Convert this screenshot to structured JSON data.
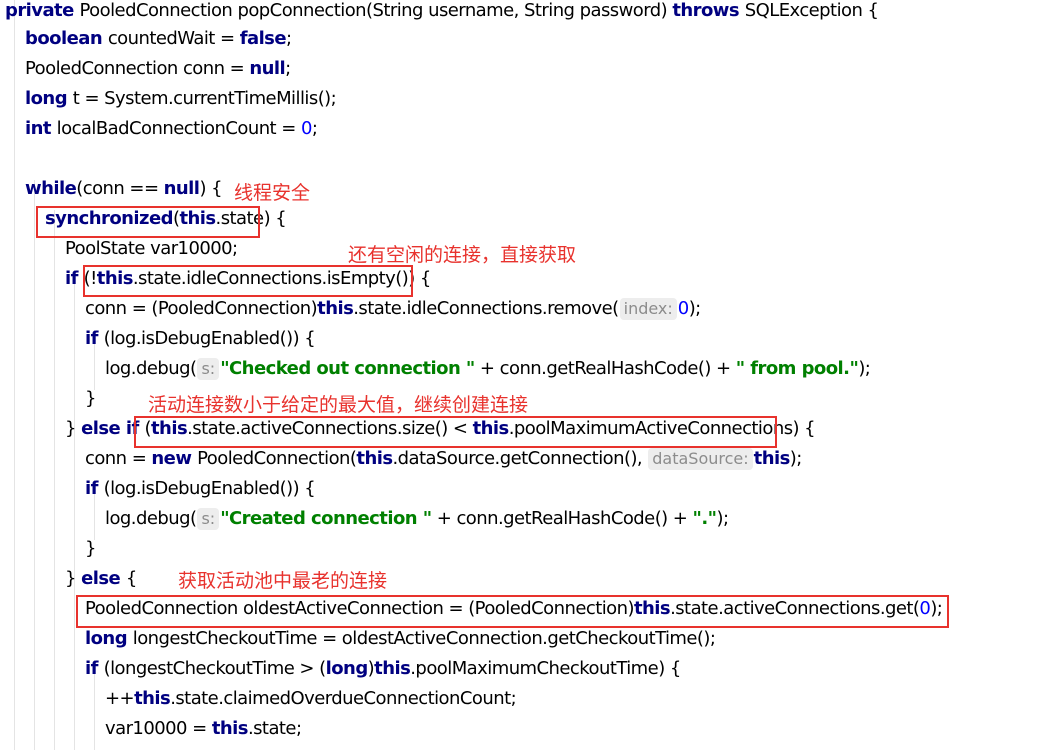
{
  "code_lines": [
    {
      "tokens": [
        {
          "t": "kw",
          "v": "private "
        },
        {
          "t": "p",
          "v": "PooledConnection popConnection(String username, String password) "
        },
        {
          "t": "kw",
          "v": "throws "
        },
        {
          "t": "p",
          "v": "SQLException {"
        }
      ]
    },
    {
      "tokens": [
        {
          "t": "kw",
          "v": "boolean "
        },
        {
          "t": "p",
          "v": "countedWait = "
        },
        {
          "t": "kw",
          "v": "false"
        },
        {
          "t": "p",
          "v": ";"
        }
      ]
    },
    {
      "tokens": [
        {
          "t": "p",
          "v": "PooledConnection conn = "
        },
        {
          "t": "kw",
          "v": "null"
        },
        {
          "t": "p",
          "v": ";"
        }
      ]
    },
    {
      "tokens": [
        {
          "t": "kw",
          "v": "long "
        },
        {
          "t": "p",
          "v": "t = System.currentTimeMillis();"
        }
      ]
    },
    {
      "tokens": [
        {
          "t": "kw",
          "v": "int "
        },
        {
          "t": "p",
          "v": "localBadConnectionCount = "
        },
        {
          "t": "num",
          "v": "0"
        },
        {
          "t": "p",
          "v": ";"
        }
      ]
    },
    {
      "tokens": []
    },
    {
      "tokens": [
        {
          "t": "kw",
          "v": "while"
        },
        {
          "t": "p",
          "v": "(conn == "
        },
        {
          "t": "kw",
          "v": "null"
        },
        {
          "t": "p",
          "v": ") {"
        }
      ]
    },
    {
      "tokens": [
        {
          "t": "kw",
          "v": "synchronized"
        },
        {
          "t": "p",
          "v": "("
        },
        {
          "t": "kw",
          "v": "this"
        },
        {
          "t": "p",
          "v": ".state) {"
        }
      ]
    },
    {
      "tokens": [
        {
          "t": "p",
          "v": "PoolState var10000;"
        }
      ]
    },
    {
      "tokens": [
        {
          "t": "kw",
          "v": "if "
        },
        {
          "t": "p",
          "v": "(!"
        },
        {
          "t": "kw",
          "v": "this"
        },
        {
          "t": "p",
          "v": ".state.idleConnections.isEmpty()) {"
        }
      ]
    },
    {
      "tokens": [
        {
          "t": "p",
          "v": "conn = (PooledConnection)"
        },
        {
          "t": "kw",
          "v": "this"
        },
        {
          "t": "p",
          "v": ".state.idleConnections.remove("
        },
        {
          "t": "hint",
          "v": "index:"
        },
        {
          "t": "num",
          "v": "0"
        },
        {
          "t": "p",
          "v": ");"
        }
      ]
    },
    {
      "tokens": [
        {
          "t": "kw",
          "v": "if "
        },
        {
          "t": "p",
          "v": "(log.isDebugEnabled()) {"
        }
      ]
    },
    {
      "tokens": [
        {
          "t": "p",
          "v": "log.debug("
        },
        {
          "t": "hint",
          "v": "s:"
        },
        {
          "t": "str",
          "v": "\"Checked out connection \""
        },
        {
          "t": "p",
          "v": " + conn.getRealHashCode() + "
        },
        {
          "t": "str",
          "v": "\" from pool.\""
        },
        {
          "t": "p",
          "v": ");"
        }
      ]
    },
    {
      "tokens": [
        {
          "t": "p",
          "v": "}"
        }
      ]
    },
    {
      "tokens": [
        {
          "t": "p",
          "v": "} "
        },
        {
          "t": "kw",
          "v": "else if "
        },
        {
          "t": "p",
          "v": "("
        },
        {
          "t": "kw",
          "v": "this"
        },
        {
          "t": "p",
          "v": ".state.activeConnections.size() < "
        },
        {
          "t": "kw",
          "v": "this"
        },
        {
          "t": "p",
          "v": ".poolMaximumActiveConnections) {"
        }
      ]
    },
    {
      "tokens": [
        {
          "t": "p",
          "v": "conn = "
        },
        {
          "t": "kw",
          "v": "new "
        },
        {
          "t": "p",
          "v": "PooledConnection("
        },
        {
          "t": "kw",
          "v": "this"
        },
        {
          "t": "p",
          "v": ".dataSource.getConnection(), "
        },
        {
          "t": "hint",
          "v": "dataSource:"
        },
        {
          "t": "kw",
          "v": "this"
        },
        {
          "t": "p",
          "v": ");"
        }
      ]
    },
    {
      "tokens": [
        {
          "t": "kw",
          "v": "if "
        },
        {
          "t": "p",
          "v": "(log.isDebugEnabled()) {"
        }
      ]
    },
    {
      "tokens": [
        {
          "t": "p",
          "v": "log.debug("
        },
        {
          "t": "hint",
          "v": "s:"
        },
        {
          "t": "str",
          "v": "\"Created connection \""
        },
        {
          "t": "p",
          "v": " + conn.getRealHashCode() + "
        },
        {
          "t": "str",
          "v": "\".\""
        },
        {
          "t": "p",
          "v": ");"
        }
      ]
    },
    {
      "tokens": [
        {
          "t": "p",
          "v": "}"
        }
      ]
    },
    {
      "tokens": [
        {
          "t": "p",
          "v": "} "
        },
        {
          "t": "kw",
          "v": "else "
        },
        {
          "t": "p",
          "v": "{"
        }
      ]
    },
    {
      "tokens": [
        {
          "t": "p",
          "v": "PooledConnection oldestActiveConnection = (PooledConnection)"
        },
        {
          "t": "kw",
          "v": "this"
        },
        {
          "t": "p",
          "v": ".state.activeConnections.get("
        },
        {
          "t": "num",
          "v": "0"
        },
        {
          "t": "p",
          "v": ");"
        }
      ]
    },
    {
      "tokens": [
        {
          "t": "kw",
          "v": "long "
        },
        {
          "t": "p",
          "v": "longestCheckoutTime = oldestActiveConnection.getCheckoutTime();"
        }
      ]
    },
    {
      "tokens": [
        {
          "t": "kw",
          "v": "if "
        },
        {
          "t": "p",
          "v": "(longestCheckoutTime > ("
        },
        {
          "t": "kw",
          "v": "long"
        },
        {
          "t": "p",
          "v": ")"
        },
        {
          "t": "kw",
          "v": "this"
        },
        {
          "t": "p",
          "v": ".poolMaximumCheckoutTime) {"
        }
      ]
    },
    {
      "tokens": [
        {
          "t": "p",
          "v": "++"
        },
        {
          "t": "kw",
          "v": "this"
        },
        {
          "t": "p",
          "v": ".state.claimedOverdueConnectionCount;"
        }
      ]
    },
    {
      "tokens": [
        {
          "t": "p",
          "v": "var10000 = "
        },
        {
          "t": "kw",
          "v": "this"
        },
        {
          "t": "p",
          "v": ".state;"
        }
      ]
    }
  ],
  "annotations": {
    "thread_safe": "线程安全",
    "idle_available": "还有空闲的连接，直接获取",
    "active_below_max": "活动连接数小于给定的最大值，继续创建连接",
    "oldest_active": "获取活动池中最老的连接"
  },
  "colors": {
    "keyword": "#000080",
    "string": "#008000",
    "number": "#0000ff",
    "annotation": "#e8322d",
    "hint_bg": "#ededed"
  }
}
